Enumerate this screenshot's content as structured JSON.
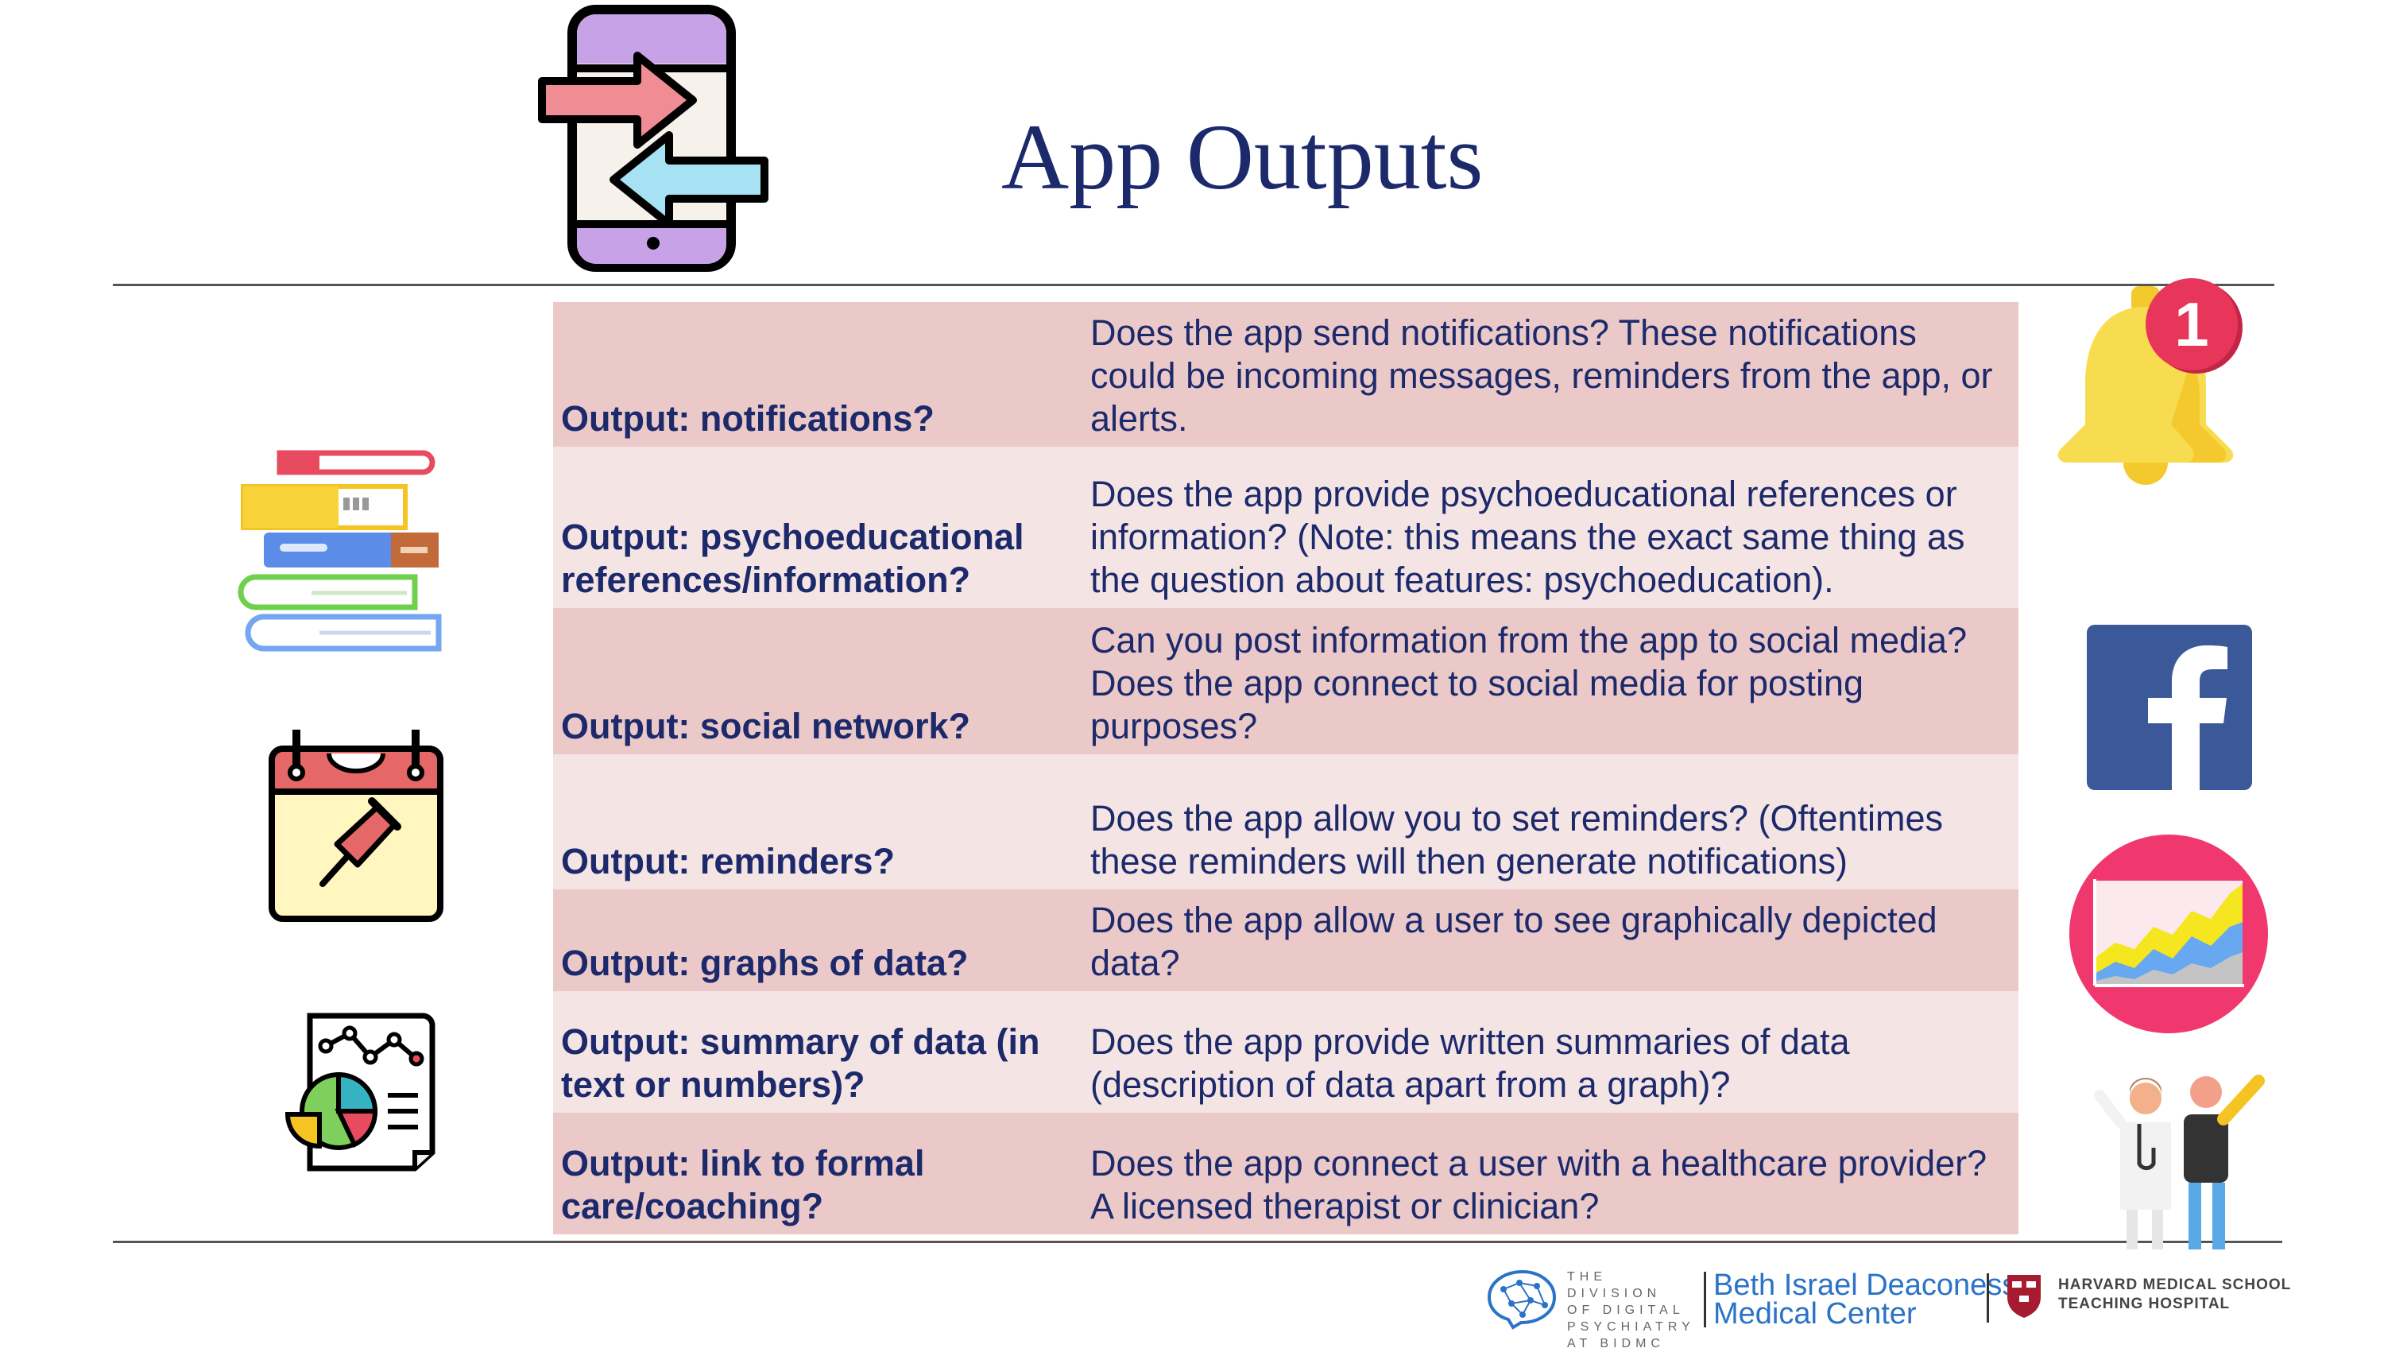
{
  "slide": {
    "title": "App Outputs"
  },
  "table": {
    "rows": [
      {
        "label": "Output: notifications?",
        "description": "Does the app send notifications? These notifications could be incoming messages, reminders from the app, or alerts."
      },
      {
        "label": "Output: psychoeducational references/information?",
        "description": "Does the app provide psychoeducational references or information? (Note: this means the exact same thing as the question about features: psychoeducation)."
      },
      {
        "label": "Output: social network?",
        "description": "Can you post information from the app to social media? Does the app connect to social media for posting purposes?"
      },
      {
        "label": "Output: reminders?",
        "description": "Does the app allow you to set reminders? (Oftentimes these reminders will then generate notifications)"
      },
      {
        "label": "Output: graphs of data?",
        "description": "Does the app allow a user to see graphically depicted data?"
      },
      {
        "label": "Output: summary of data (in text or numbers)?",
        "description": "Does the app provide written summaries of data (description of data apart from a graph)?"
      },
      {
        "label": "Output: link to formal care/coaching?",
        "description": "Does the app connect a user with a healthcare provider? A licensed therapist or clinician?"
      }
    ]
  },
  "badges": {
    "notification_count": "1"
  },
  "footer": {
    "division_text": "THE DIVISION OF DIGITAL PSYCHIATRY AT BIDMC",
    "bidmc_line1": "Beth Israel Deaconess",
    "bidmc_line2": "Medical Center",
    "hms_line1": "HARVARD MEDICAL SCHOOL",
    "hms_line2": "TEACHING HOSPITAL"
  },
  "icons": [
    "phone-transfer-icon",
    "books-icon",
    "calendar-pin-icon",
    "report-chart-icon",
    "bell-icon",
    "facebook-icon",
    "area-chart-icon",
    "doctor-patient-icon",
    "brain-logo-icon",
    "harvard-shield-icon"
  ],
  "colors": {
    "title": "#1c2a6b",
    "row_dark": "#ebc9c9",
    "row_light": "#f5e4e4",
    "accent_blue": "#2b73c6"
  }
}
